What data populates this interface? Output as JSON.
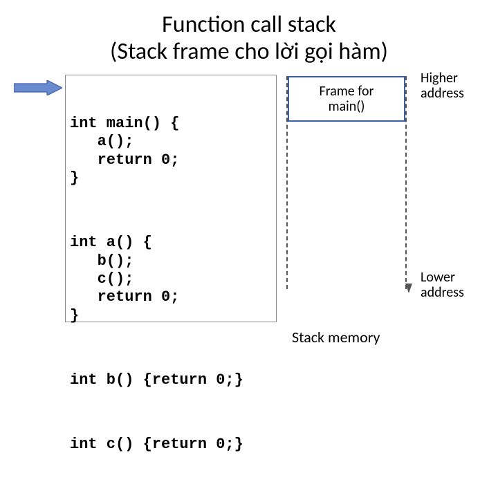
{
  "title_line1": "Function call stack",
  "title_line2": "(Stack frame cho lời gọi hàm)",
  "code": {
    "main": "int main() {\n   a();\n   return 0;\n}",
    "a": "int a() {\n   b();\n   c();\n   return 0;\n}",
    "b": "int b() {return 0;}",
    "c": "int c() {return 0;}"
  },
  "stack": {
    "frame_main": "Frame for\nmain()",
    "memory_label": "Stack memory"
  },
  "addr": {
    "higher": "Higher\naddress",
    "lower": "Lower\naddress"
  },
  "colors": {
    "arrow_fill": "#6a8bd0",
    "arrow_stroke": "#3a5ea8"
  }
}
